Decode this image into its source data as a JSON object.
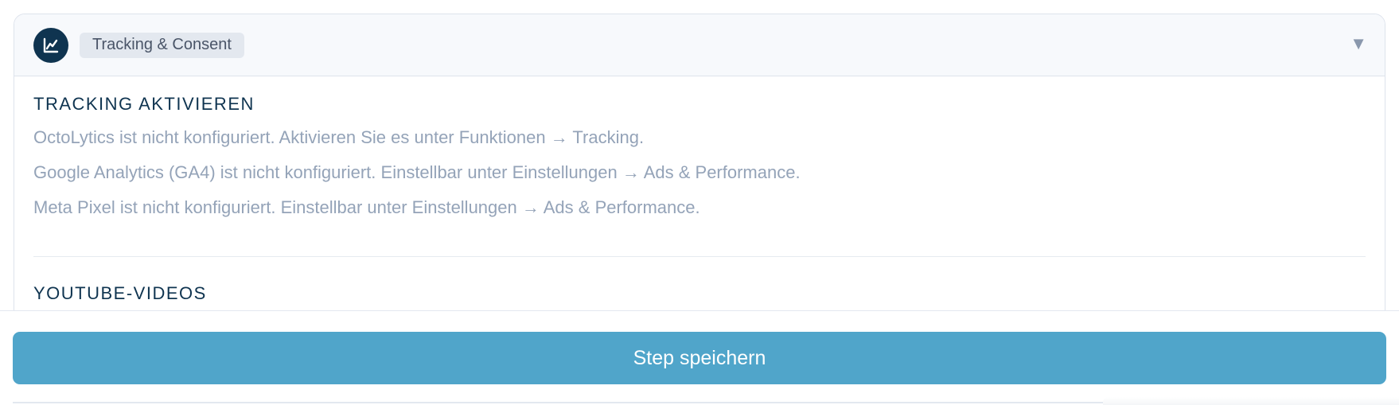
{
  "header": {
    "icon": "chart-line-icon",
    "tag_label": "Tracking & Consent",
    "chevron": "▼"
  },
  "tracking": {
    "title": "TRACKING AKTIVIEREN",
    "lines": [
      "OctoLytics ist nicht konfiguriert. Aktivieren Sie es unter Funktionen → Tracking.",
      "Google Analytics (GA4) ist nicht konfiguriert. Einstellbar unter Einstellungen → Ads & Performance.",
      "Meta Pixel ist nicht konfiguriert. Einstellbar unter Einstellungen → Ads & Performance."
    ]
  },
  "youtube": {
    "title": "YOUTUBE-VIDEOS"
  },
  "footer": {
    "save_label": "Step speichern"
  },
  "colors": {
    "accent": "#50a5ca",
    "navy": "#0f3450",
    "muted_text": "#94a3b8"
  }
}
